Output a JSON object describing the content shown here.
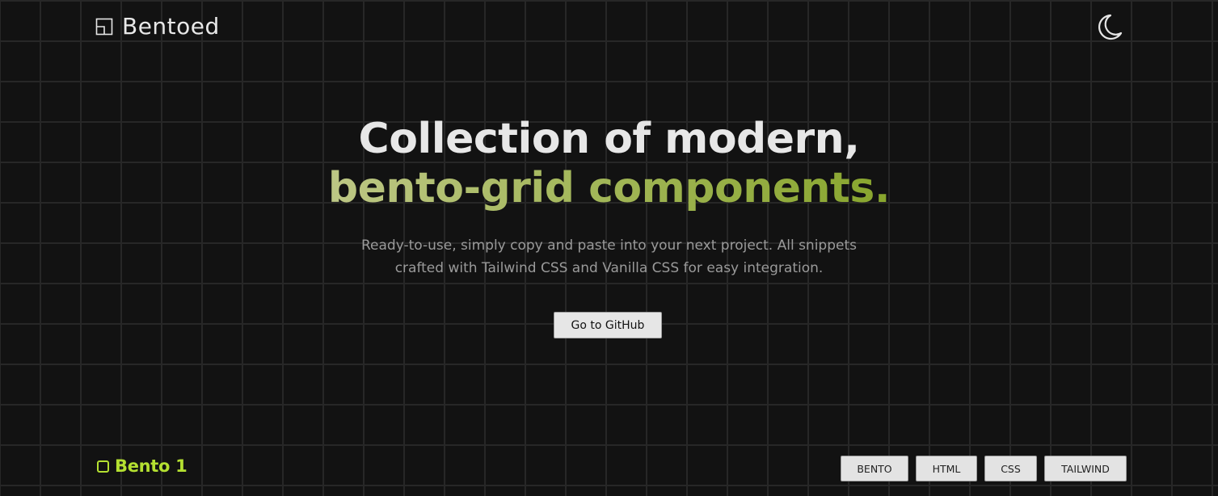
{
  "header": {
    "logo_text": "Bentoed",
    "logo_icon": "layout-square-icon",
    "theme_toggle_icon": "moon-icon"
  },
  "hero": {
    "headline_line1": "Collection of modern,",
    "headline_line2": "bento-grid components.",
    "subtitle_line1": "Ready-to-use, simply copy and paste into your next project. All snippets",
    "subtitle_line2": "crafted with Tailwind CSS and Vanilla CSS for easy integration.",
    "cta_label": "Go to GitHub"
  },
  "section": {
    "title": "Bento 1",
    "tags": [
      "BENTO",
      "HTML",
      "CSS",
      "TAILWIND"
    ]
  },
  "colors": {
    "background": "#121212",
    "grid_line": "#272727",
    "accent": "#b4e031",
    "gradient_start": "#d9ddc4",
    "gradient_end": "#7a9a1e"
  }
}
